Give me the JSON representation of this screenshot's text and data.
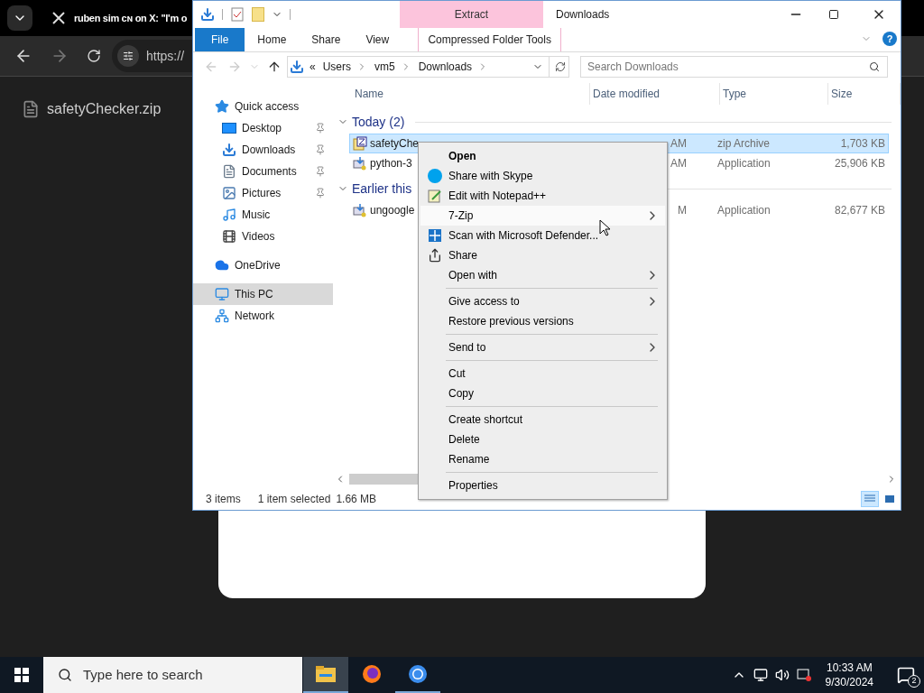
{
  "browser": {
    "tab_title": "ruben sim ᴄɴ on X: \"I'm o",
    "address": "https://",
    "download": {
      "name": "safetyChecker.zip"
    }
  },
  "explorer": {
    "title": "Downloads",
    "contextual_group": "Extract",
    "ribbon_tabs": [
      {
        "label": "File",
        "selected": true,
        "contextual": false
      },
      {
        "label": "Home",
        "selected": false,
        "contextual": false
      },
      {
        "label": "Share",
        "selected": false,
        "contextual": false
      },
      {
        "label": "View",
        "selected": false,
        "contextual": false
      },
      {
        "label": "Compressed Folder Tools",
        "selected": false,
        "contextual": true
      }
    ],
    "breadcrumb_overflow": "«",
    "breadcrumb": [
      "Users",
      "vm5",
      "Downloads"
    ],
    "search": {
      "placeholder": "Search Downloads"
    },
    "sidebar": [
      {
        "label": "Quick access",
        "selected": false,
        "pinned": false,
        "children": [
          {
            "label": "Desktop",
            "selected": false,
            "pinned": true
          },
          {
            "label": "Downloads",
            "selected": false,
            "pinned": true
          },
          {
            "label": "Documents",
            "selected": false,
            "pinned": true
          },
          {
            "label": "Pictures",
            "selected": false,
            "pinned": true
          },
          {
            "label": "Music",
            "selected": false,
            "pinned": false
          },
          {
            "label": "Videos",
            "selected": false,
            "pinned": false
          }
        ]
      },
      {
        "label": "OneDrive",
        "selected": false,
        "pinned": false
      },
      {
        "label": "This PC",
        "selected": true,
        "pinned": false
      },
      {
        "label": "Network",
        "selected": false,
        "pinned": false
      }
    ],
    "columns": [
      "Name",
      "Date modified",
      "Type",
      "Size"
    ],
    "groups": [
      {
        "label": "Today (2)",
        "expanded": true,
        "files": [
          {
            "kind": "archive",
            "name": "safetyChe",
            "date": "AM",
            "type": "zip Archive",
            "size": "1,703 KB",
            "selected": true
          },
          {
            "kind": "application",
            "name": "python-3",
            "date": "AM",
            "type": "Application",
            "size": "25,906 KB",
            "selected": false
          }
        ]
      },
      {
        "label": "Earlier this",
        "expanded": true,
        "files": [
          {
            "kind": "application",
            "name": "ungoogle",
            "date": "M",
            "type": "Application",
            "size": "82,677 KB",
            "selected": false
          }
        ]
      }
    ],
    "status": {
      "count": "3 items",
      "selection": "1 item selected",
      "size": "1.66 MB"
    },
    "help_label": "?",
    "view_buttons": [
      {
        "kind": "details",
        "selected": true
      },
      {
        "kind": "large_icons",
        "selected": false
      }
    ]
  },
  "context_menu": [
    {
      "kind": "item",
      "label": "Open",
      "default": true,
      "icon": false,
      "submenu": false,
      "selected": false
    },
    {
      "kind": "item",
      "label": "Share with Skype",
      "default": false,
      "icon": true,
      "submenu": false,
      "selected": false
    },
    {
      "kind": "item",
      "label": "Edit with Notepad++",
      "default": false,
      "icon": true,
      "submenu": false,
      "selected": false
    },
    {
      "kind": "item",
      "label": "7-Zip",
      "default": false,
      "icon": false,
      "submenu": true,
      "selected": true
    },
    {
      "kind": "item",
      "label": "Scan with Microsoft Defender...",
      "default": false,
      "icon": true,
      "submenu": false,
      "selected": false
    },
    {
      "kind": "item",
      "label": "Share",
      "default": false,
      "icon": true,
      "submenu": false,
      "selected": false
    },
    {
      "kind": "item",
      "label": "Open with",
      "default": false,
      "icon": false,
      "submenu": true,
      "selected": false
    },
    {
      "kind": "separator"
    },
    {
      "kind": "item",
      "label": "Give access to",
      "default": false,
      "icon": false,
      "submenu": true,
      "selected": false
    },
    {
      "kind": "item",
      "label": "Restore previous versions",
      "default": false,
      "icon": false,
      "submenu": false,
      "selected": false
    },
    {
      "kind": "separator"
    },
    {
      "kind": "item",
      "label": "Send to",
      "default": false,
      "icon": false,
      "submenu": true,
      "selected": false
    },
    {
      "kind": "separator"
    },
    {
      "kind": "item",
      "label": "Cut",
      "default": false,
      "icon": false,
      "submenu": false,
      "selected": false
    },
    {
      "kind": "item",
      "label": "Copy",
      "default": false,
      "icon": false,
      "submenu": false,
      "selected": false
    },
    {
      "kind": "separator"
    },
    {
      "kind": "item",
      "label": "Create shortcut",
      "default": false,
      "icon": false,
      "submenu": false,
      "selected": false
    },
    {
      "kind": "item",
      "label": "Delete",
      "default": false,
      "icon": false,
      "submenu": false,
      "selected": false
    },
    {
      "kind": "item",
      "label": "Rename",
      "default": false,
      "icon": false,
      "submenu": false,
      "selected": false
    },
    {
      "kind": "separator"
    },
    {
      "kind": "item",
      "label": "Properties",
      "default": false,
      "icon": false,
      "submenu": false,
      "selected": false
    }
  ],
  "taskbar": {
    "search_placeholder": "Type here to search",
    "apps": [
      {
        "active": true,
        "running": true
      },
      {
        "active": false,
        "running": false
      },
      {
        "active": false,
        "running": true
      }
    ],
    "time": "10:33 AM",
    "date": "9/30/2024",
    "notifications": "2"
  }
}
